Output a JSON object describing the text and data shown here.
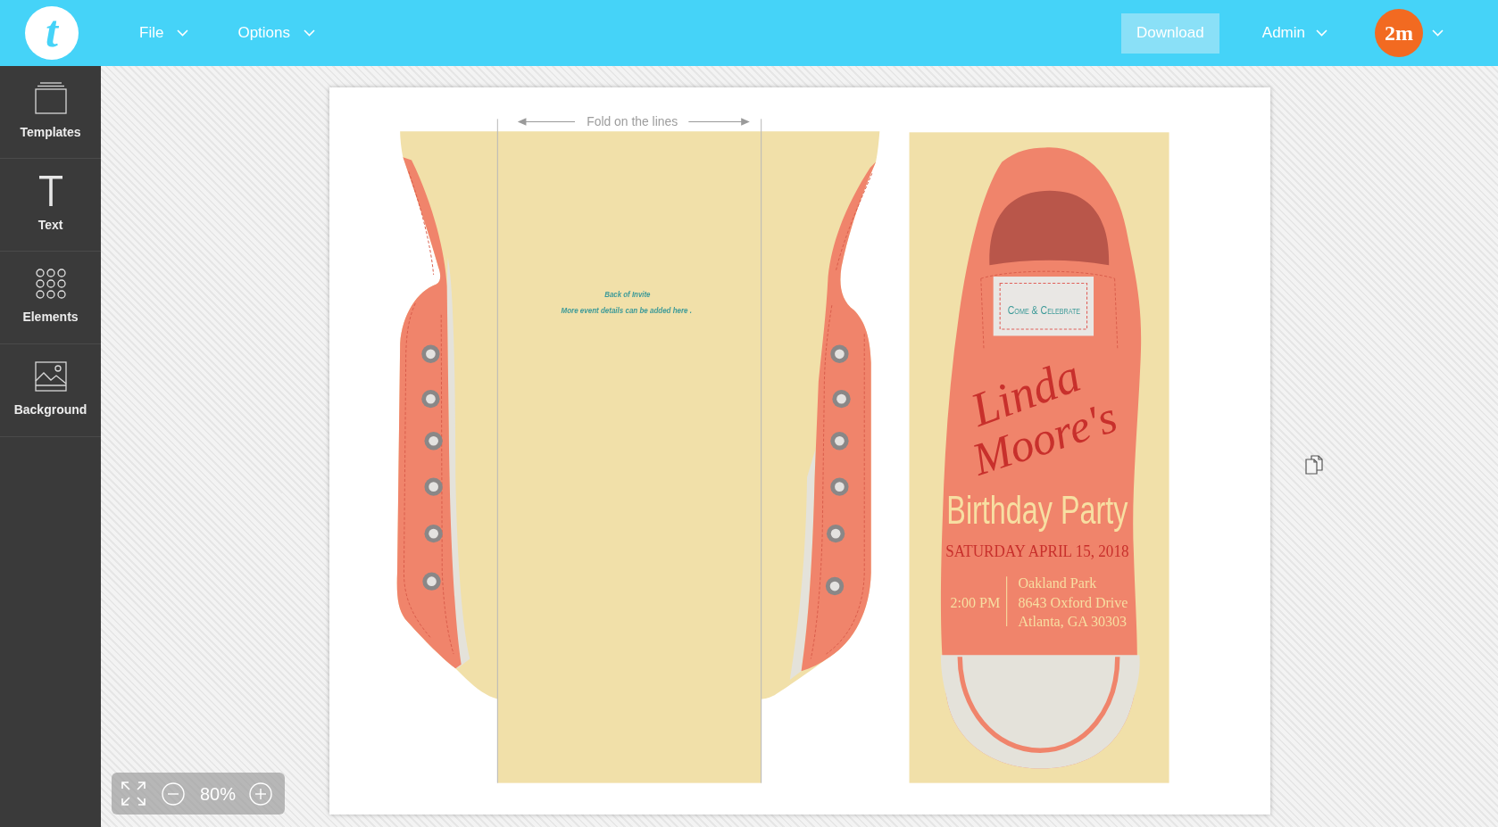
{
  "top_bar": {
    "logo": "t",
    "menus": [
      {
        "label": "File"
      },
      {
        "label": "Options"
      }
    ],
    "download_button": "Download",
    "admin_menu": "Admin",
    "avatar": "2m"
  },
  "sidebar": {
    "items": [
      {
        "kind": "templates",
        "label": "Templates",
        "selected": false
      },
      {
        "kind": "text",
        "label": "Text",
        "selected": false
      },
      {
        "kind": "elements",
        "label": "Elements",
        "selected": false
      },
      {
        "kind": "background",
        "label": "Background",
        "selected": false
      }
    ]
  },
  "invitation": {
    "fold_hint": "Fold on the lines",
    "back_lines": [
      "Back of Invite",
      "More event details can be added here ."
    ],
    "tag": "Come & Celebrate",
    "name_lines": [
      "Linda",
      "Moore's"
    ],
    "title": "Birthday Party",
    "date": "SATURDAY APRIL 15, 2018",
    "time": "2:00 PM",
    "address_lines": [
      "Oakland Park",
      "8643 Oxford Drive",
      "Atlanta, GA 30303"
    ]
  },
  "zoom": {
    "value": "80%"
  }
}
